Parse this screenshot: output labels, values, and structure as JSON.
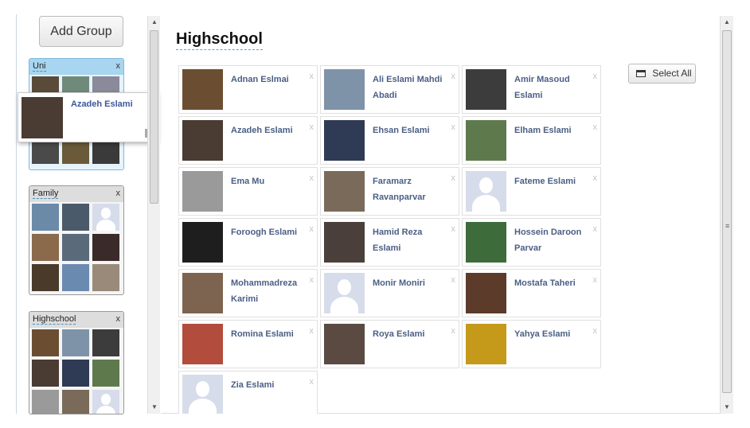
{
  "sidebar": {
    "add_group_label": "Add Group",
    "groups": [
      {
        "name": "Uni",
        "close": "x"
      },
      {
        "name": "Family",
        "close": "x"
      },
      {
        "name": "Highschool",
        "close": "x"
      }
    ],
    "dragging_card": {
      "name": "Azadeh Eslami",
      "close": "x",
      "badge": "f"
    }
  },
  "main": {
    "title": "Highschool",
    "select_all_label": "Select All",
    "friends": [
      {
        "name": "Adnan Eslmai",
        "close": "x",
        "photo": "#6b4e32"
      },
      {
        "name": "Ali Eslami Mahdi Abadi",
        "close": "x",
        "photo": "#7f93a8"
      },
      {
        "name": "Amir Masoud Eslami",
        "close": "x",
        "photo": "#3c3c3c"
      },
      {
        "name": "Azadeh Eslami",
        "close": "x",
        "photo": "#4a3b33"
      },
      {
        "name": "Ehsan Eslami",
        "close": "x",
        "photo": "#2f3b55"
      },
      {
        "name": "Elham Eslami",
        "close": "x",
        "photo": "#5e7a4c"
      },
      {
        "name": "Ema Mu",
        "close": "x",
        "photo": "#9a9a9a"
      },
      {
        "name": "Faramarz Ravanparvar",
        "close": "x",
        "photo": "#7a6a5a"
      },
      {
        "name": "Fateme Eslami",
        "close": "x",
        "photo": "silhouette"
      },
      {
        "name": "Foroogh Eslami",
        "close": "x",
        "photo": "#1e1e1e"
      },
      {
        "name": "Hamid Reza Eslami",
        "close": "x",
        "photo": "#4a3f3a"
      },
      {
        "name": "Hossein Daroon Parvar",
        "close": "x",
        "photo": "#3d6b3a"
      },
      {
        "name": "Mohammadreza Karimi",
        "close": "x",
        "photo": "#7d6450"
      },
      {
        "name": "Monir Moniri",
        "close": "x",
        "photo": "silhouette"
      },
      {
        "name": "Mostafa Taheri",
        "close": "x",
        "photo": "#5d3b2b"
      },
      {
        "name": "Romina Eslami",
        "close": "x",
        "photo": "#b24c3c"
      },
      {
        "name": "Roya Eslami",
        "close": "x",
        "photo": "#5a4a42"
      },
      {
        "name": "Yahya Eslami",
        "close": "x",
        "photo": "#c59a1a"
      },
      {
        "name": "Zia Eslami",
        "close": "x",
        "photo": "silhouette"
      }
    ]
  },
  "group_thumbnails": {
    "uni": [
      "#5a4a3a",
      "#6f8a7a",
      "#8a8a9a",
      "",
      "",
      "",
      "#4a4a4a",
      "#6a5a3a",
      "#3a3a3a"
    ],
    "family": [
      "#6a8aa8",
      "#4a5a6a",
      "silhouette",
      "#8a6a4a",
      "#5a6a7a",
      "#3a2a2a",
      "#4a3a2a",
      "#6a8ab0",
      "#9a8a7a"
    ],
    "highschool": [
      "#6b4e32",
      "#7f93a8",
      "#3c3c3c",
      "#4a3b33",
      "#2f3b55",
      "#5e7a4c",
      "#9a9a9a",
      "#7a6a5a",
      "silhouette"
    ]
  },
  "colors": {
    "accent": "#3b5998",
    "selected_group": "#a8d5ef"
  }
}
